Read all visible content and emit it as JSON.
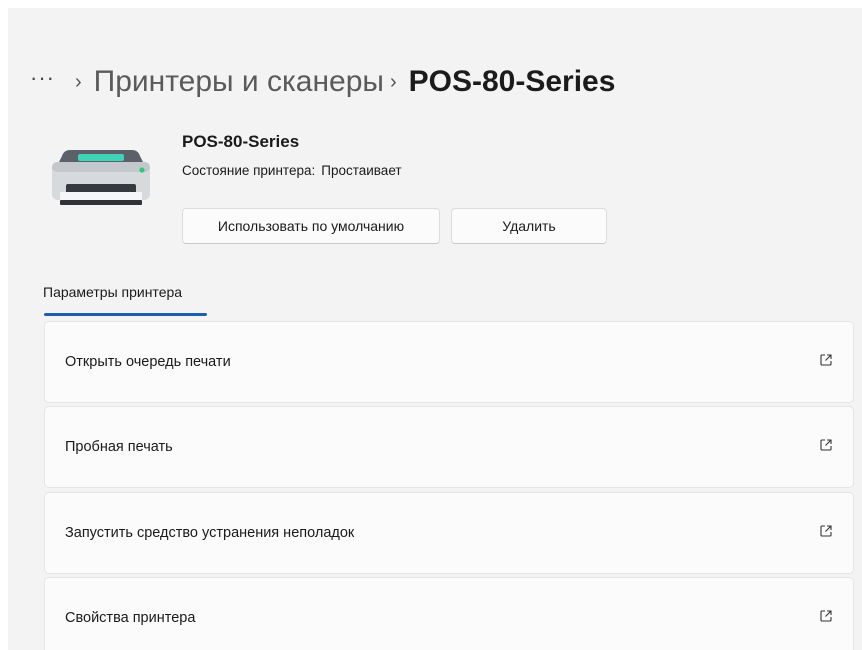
{
  "breadcrumb": {
    "more": "···",
    "separator": "›",
    "parent": "Принтеры и сканеры",
    "current": "POS-80-Series"
  },
  "device": {
    "name": "POS-80-Series",
    "status_label": "Состояние принтера:",
    "status_value": "Простаивает",
    "icon": "printer-icon"
  },
  "actions": {
    "set_default": "Использовать по умолчанию",
    "remove": "Удалить"
  },
  "tabs": [
    {
      "label": "Параметры принтера",
      "selected": true
    }
  ],
  "settings": [
    {
      "label": "Открыть очередь печати",
      "icon": "open-external-icon"
    },
    {
      "label": "Пробная печать",
      "icon": "open-external-icon"
    },
    {
      "label": "Запустить средство устранения неполадок",
      "icon": "open-external-icon"
    },
    {
      "label": "Свойства принтера",
      "icon": "open-external-icon"
    }
  ],
  "colors": {
    "accent": "#1a5fb4",
    "background": "#f3f3f3",
    "card": "#fbfbfb"
  }
}
